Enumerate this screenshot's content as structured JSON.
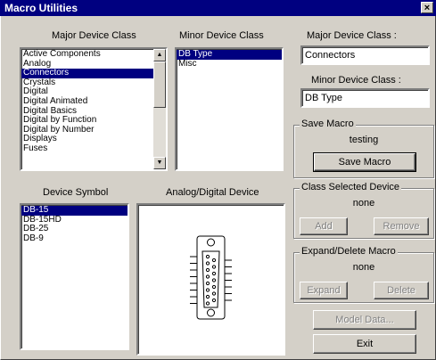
{
  "window": {
    "title": "Macro Utilities",
    "close_glyph": "×"
  },
  "major_class": {
    "header": "Major Device Class",
    "items": [
      "Active Components",
      "Analog",
      "Connectors",
      "Crystals",
      "Digital",
      "Digital Animated",
      "Digital Basics",
      "Digital by Function",
      "Digital by Number",
      "Displays",
      "Fuses"
    ],
    "selected_index": 2
  },
  "minor_class": {
    "header": "Minor Device Class",
    "items": [
      "DB Type",
      "Misc"
    ],
    "selected_index": 0
  },
  "right_panel": {
    "major_label": "Major Device Class :",
    "major_value": "Connectors",
    "minor_label": "Minor Device Class :",
    "minor_value": "DB Type"
  },
  "save_macro": {
    "title": "Save Macro",
    "value": "testing",
    "button": "Save Macro"
  },
  "class_selected": {
    "title": "Class Selected Device",
    "value": "none",
    "add": "Add",
    "remove": "Remove"
  },
  "expand_delete": {
    "title": "Expand/Delete Macro",
    "value": "none",
    "expand": "Expand",
    "delete": "Delete"
  },
  "buttons": {
    "model_data": "Model Data...",
    "exit": "Exit"
  },
  "device_symbol": {
    "header": "Device Symbol",
    "items": [
      "DB-15",
      "DB-15HD",
      "DB-25",
      "DB-9"
    ],
    "selected_index": 0
  },
  "preview": {
    "header": "Analog/Digital Device",
    "icon": "db15-connector-icon"
  }
}
